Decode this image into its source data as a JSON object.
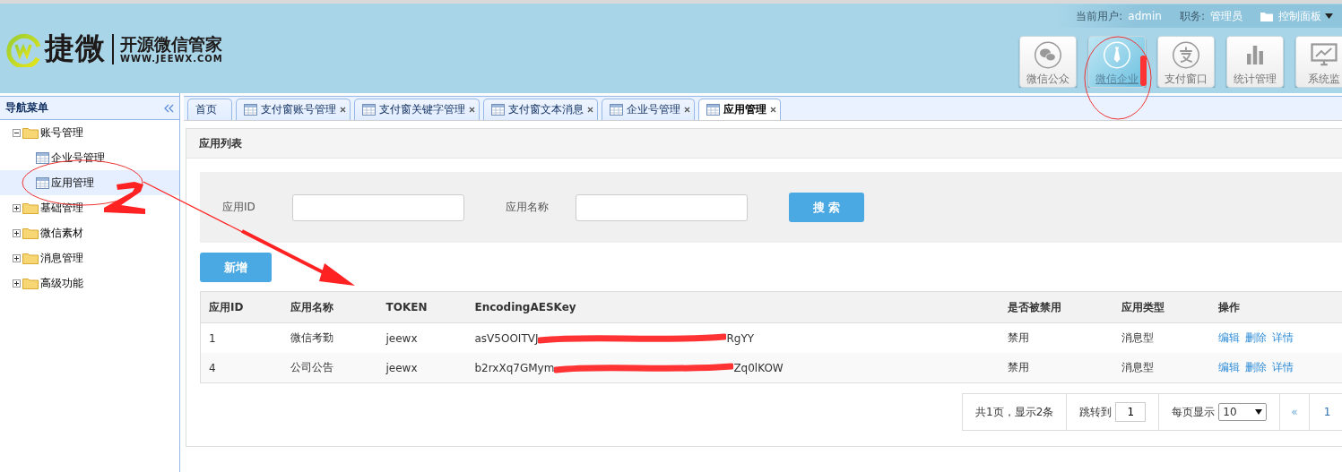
{
  "logo": {
    "brand": "捷微",
    "tagline": "开源微信管家",
    "url": "WWW.JEEWX.COM"
  },
  "user_bar": {
    "user_label": "当前用户:",
    "user": "admin",
    "role_label": "职务:",
    "role": "管理员",
    "panel": "控制面板"
  },
  "nav_buttons": [
    {
      "label": "微信公众",
      "kind": "chat",
      "selected": false
    },
    {
      "label": "微信企业",
      "kind": "tie",
      "selected": true
    },
    {
      "label": "支付窗口",
      "kind": "pay",
      "selected": false
    },
    {
      "label": "统计管理",
      "kind": "bars",
      "selected": false
    },
    {
      "label": "系统监",
      "kind": "monitor",
      "selected": false
    }
  ],
  "sidebar": {
    "title": "导航菜单",
    "items": [
      {
        "label": "账号管理",
        "expanded": true,
        "selected": false,
        "children": [
          {
            "label": "企业号管理",
            "selected": false
          },
          {
            "label": "应用管理",
            "selected": true
          }
        ]
      },
      {
        "label": "基础管理",
        "expanded": false,
        "selected": false
      },
      {
        "label": "微信素材",
        "expanded": false,
        "selected": false
      },
      {
        "label": "消息管理",
        "expanded": false,
        "selected": false
      },
      {
        "label": "高级功能",
        "expanded": false,
        "selected": false
      }
    ]
  },
  "tabs": [
    {
      "label": "首页",
      "kind": "home",
      "selected": false
    },
    {
      "label": "支付窗账号管理",
      "kind": "page",
      "selected": false
    },
    {
      "label": "支付窗关键字管理",
      "kind": "page",
      "selected": false
    },
    {
      "label": "支付窗文本消息",
      "kind": "page",
      "selected": false
    },
    {
      "label": "企业号管理",
      "kind": "page",
      "selected": false
    },
    {
      "label": "应用管理",
      "kind": "page",
      "selected": true
    }
  ],
  "panel": {
    "title": "应用列表",
    "search": {
      "fields": [
        {
          "label": "应用ID"
        },
        {
          "label": "应用名称"
        }
      ],
      "button": "搜 索"
    },
    "add_button": "新增",
    "table": {
      "columns": [
        "应用ID",
        "应用名称",
        "TOKEN",
        "EncodingAESKey",
        "是否被禁用",
        "应用类型",
        "操作"
      ],
      "rows": [
        {
          "id": "1",
          "name": "微信考勤",
          "token": "jeewx",
          "key_head": "asV5OOITVJ",
          "key_tail": "RgYY",
          "disabled": "禁用",
          "type": "消息型",
          "actions": [
            "编辑",
            "删除",
            "详情"
          ]
        },
        {
          "id": "4",
          "name": "公司公告",
          "token": "jeewx",
          "key_head": "b2rxXq7GMym",
          "key_tail": "Zq0lKOW",
          "disabled": "禁用",
          "type": "消息型",
          "actions": [
            "编辑",
            "删除",
            "详情"
          ]
        }
      ]
    },
    "pagination": {
      "summary": "共1页，显示2条",
      "jump_label": "跳转到",
      "jump_value": "1",
      "size_label": "每页显示",
      "size_value": "10",
      "prev": "«",
      "pages": [
        "1"
      ]
    }
  }
}
